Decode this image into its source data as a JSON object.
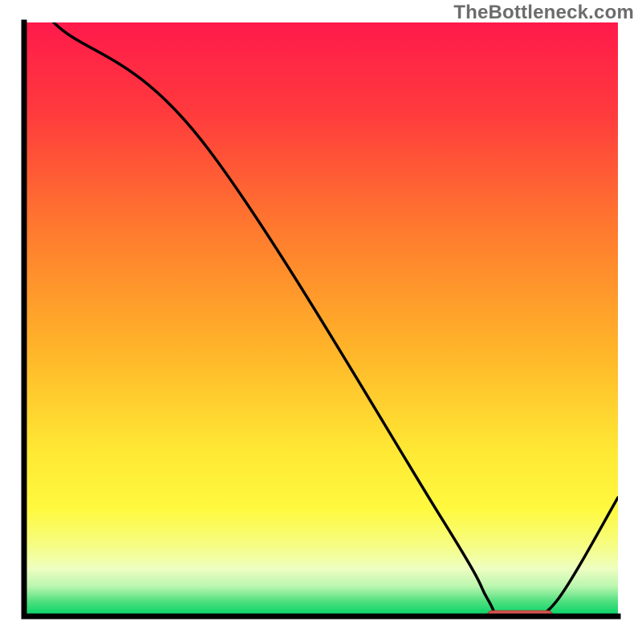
{
  "watermark": "TheBottleneck.com",
  "colors": {
    "axis": "#000000",
    "line": "#000000",
    "marker_fill": "#d9544d",
    "marker_stroke": "#a93b35"
  },
  "chart_data": {
    "type": "line",
    "title": "",
    "xlabel": "",
    "ylabel": "",
    "xlim": [
      0,
      100
    ],
    "ylim": [
      0,
      100
    ],
    "x": [
      0,
      5,
      30,
      70,
      78,
      80,
      85,
      90,
      100
    ],
    "values": [
      110,
      100,
      80,
      17,
      3,
      0,
      0,
      3,
      20
    ],
    "marker": {
      "x_start": 78,
      "x_end": 89,
      "y": 0
    },
    "gradient_stops": [
      {
        "offset": 0.0,
        "color": "#ff1a4b"
      },
      {
        "offset": 0.15,
        "color": "#ff3a3d"
      },
      {
        "offset": 0.35,
        "color": "#ff7a2e"
      },
      {
        "offset": 0.55,
        "color": "#ffb429"
      },
      {
        "offset": 0.72,
        "color": "#ffe834"
      },
      {
        "offset": 0.82,
        "color": "#fff93f"
      },
      {
        "offset": 0.88,
        "color": "#f6fd82"
      },
      {
        "offset": 0.92,
        "color": "#eefec1"
      },
      {
        "offset": 0.95,
        "color": "#b9f6af"
      },
      {
        "offset": 0.975,
        "color": "#4fe07e"
      },
      {
        "offset": 1.0,
        "color": "#00d166"
      }
    ]
  }
}
